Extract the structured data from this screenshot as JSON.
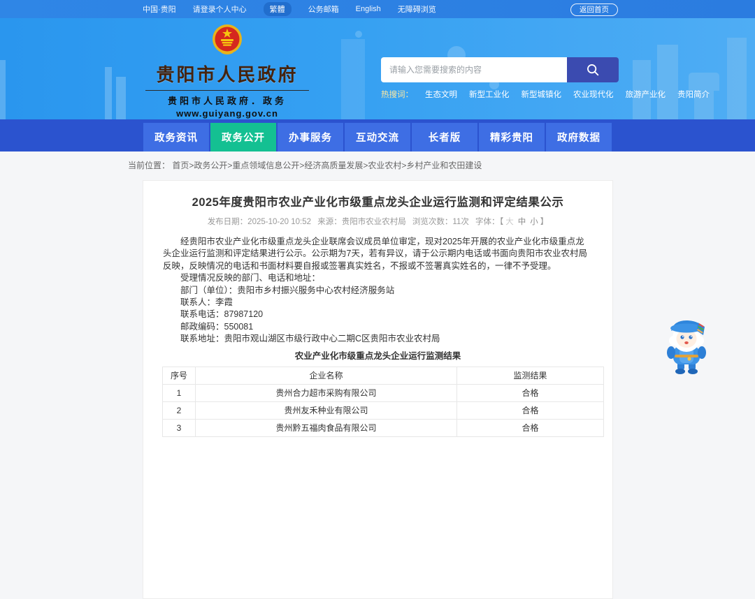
{
  "topbar": {
    "items": [
      {
        "label": "中国·贵阳"
      },
      {
        "label": "请登录个人中心"
      },
      {
        "label": "繁體"
      },
      {
        "label": "公务邮箱"
      },
      {
        "label": "English"
      },
      {
        "label": "无障碍浏览"
      }
    ],
    "home_button": "返回首页"
  },
  "header": {
    "site_title": "贵阳市人民政府",
    "site_subtitle": "贵阳市人民政府．政务",
    "site_url": "www.guiyang.gov.cn",
    "search": {
      "placeholder": "请输入您需要搜索的内容"
    },
    "hotwords": {
      "label": "热搜词：",
      "words": [
        "生态文明",
        "新型工业化",
        "新型城镇化",
        "农业现代化",
        "旅游产业化",
        "贵阳简介"
      ]
    }
  },
  "nav": {
    "items": [
      {
        "label": "政务资讯",
        "active": false
      },
      {
        "label": "政务公开",
        "active": true
      },
      {
        "label": "办事服务",
        "active": false
      },
      {
        "label": "互动交流",
        "active": false
      },
      {
        "label": "长者版",
        "active": false
      },
      {
        "label": "精彩贵阳",
        "active": false
      },
      {
        "label": "政府数据",
        "active": false
      }
    ]
  },
  "breadcrumb": {
    "label": "当前位置：",
    "path": "首页>政务公开>重点领域信息公开>经济高质量发展>农业农村>乡村产业和农田建设"
  },
  "article": {
    "title": "2025年度贵阳市农业产业化市级重点龙头企业运行监测和评定结果公示",
    "meta": {
      "publish": "发布日期：2025-10-20 10:52",
      "source": "来源：贵阳市农业农村局",
      "views": "浏览次数：11次",
      "font_label": "字体：【",
      "font_large": "大",
      "font_mid": "中",
      "font_small": "小",
      "font_close": "】"
    },
    "paragraphs": [
      "经贵阳市农业产业化市级重点龙头企业联席会议成员单位审定，现对2025年开展的农业产业化市级重点龙头企业运行监测和评定结果进行公示。公示期为7天，若有异议，请于公示期内电话或书面向贵阳市农业农村局反映，反映情况的电话和书面材料要自报或签署真实姓名，不报或不签署真实姓名的，一律不予受理。",
      "受理情况反映的部门、电话和地址：",
      "部门（单位）：贵阳市乡村振兴服务中心农村经济服务站",
      "联系人：李霞",
      "联系电话：87987120",
      "邮政编码：550081",
      "联系地址：贵阳市观山湖区市级行政中心二期C区贵阳市农业农村局"
    ],
    "table": {
      "caption": "农业产业化市级重点龙头企业运行监测结果",
      "headers": [
        "序号",
        "企业名称",
        "监测结果"
      ],
      "rows": [
        [
          "1",
          "贵州合力超市采购有限公司",
          "合格"
        ],
        [
          "2",
          "贵州友禾种业有限公司",
          "合格"
        ],
        [
          "3",
          "贵州黔五福肉食品有限公司",
          "合格"
        ]
      ]
    }
  },
  "icons": {
    "search": "search-icon",
    "emblem": "national-emblem",
    "mascot": "assistant-mascot"
  },
  "colors": {
    "topbar_blue": "#2d82e4",
    "banner_blue": "#35a0f2",
    "nav_bar": "#2b53cf",
    "nav_button": "#3e6ee4",
    "nav_active_green": "#14c092",
    "search_button_indigo": "#3b4bb0",
    "site_title_brown": "#45230e",
    "hotword_label_yellow": "#ffe9a0",
    "body_text": "#333333",
    "meta_gray": "#999999",
    "page_bg": "#f5f6f8"
  }
}
